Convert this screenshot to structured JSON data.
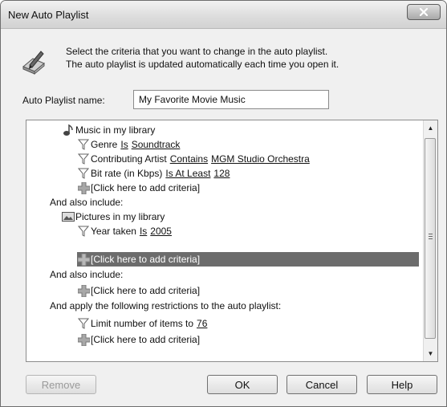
{
  "window": {
    "title": "New Auto Playlist"
  },
  "description": {
    "line1": "Select the criteria that you want to change in the auto playlist.",
    "line2": "The auto playlist is updated automatically each time you open it."
  },
  "name_field": {
    "label": "Auto Playlist name:",
    "value": "My Favorite Movie Music"
  },
  "tree": {
    "music_header": "Music in my library",
    "genre": {
      "field": "Genre",
      "op": "Is",
      "value": "Soundtrack"
    },
    "artist": {
      "field": "Contributing Artist",
      "op": "Contains",
      "value": "MGM Studio Orchestra"
    },
    "bitrate": {
      "field": "Bit rate (in Kbps)",
      "op": "Is At Least",
      "value": "128"
    },
    "add_criteria": "[Click here to add criteria]",
    "also_include": "And also include:",
    "pictures_header": "Pictures in my library",
    "year": {
      "field": "Year taken",
      "op": "Is",
      "value": "2005"
    },
    "restrictions": "And apply the following restrictions to the auto playlist:",
    "limit": {
      "field": "Limit number of items to",
      "value": "76"
    }
  },
  "buttons": {
    "remove": "Remove",
    "ok": "OK",
    "cancel": "Cancel",
    "help": "Help"
  },
  "icons": {
    "close": "close-icon",
    "playlist": "playlist-edit-icon",
    "music": "music-note-icon",
    "filter": "filter-icon",
    "add": "add-icon",
    "pictures": "picture-icon"
  }
}
